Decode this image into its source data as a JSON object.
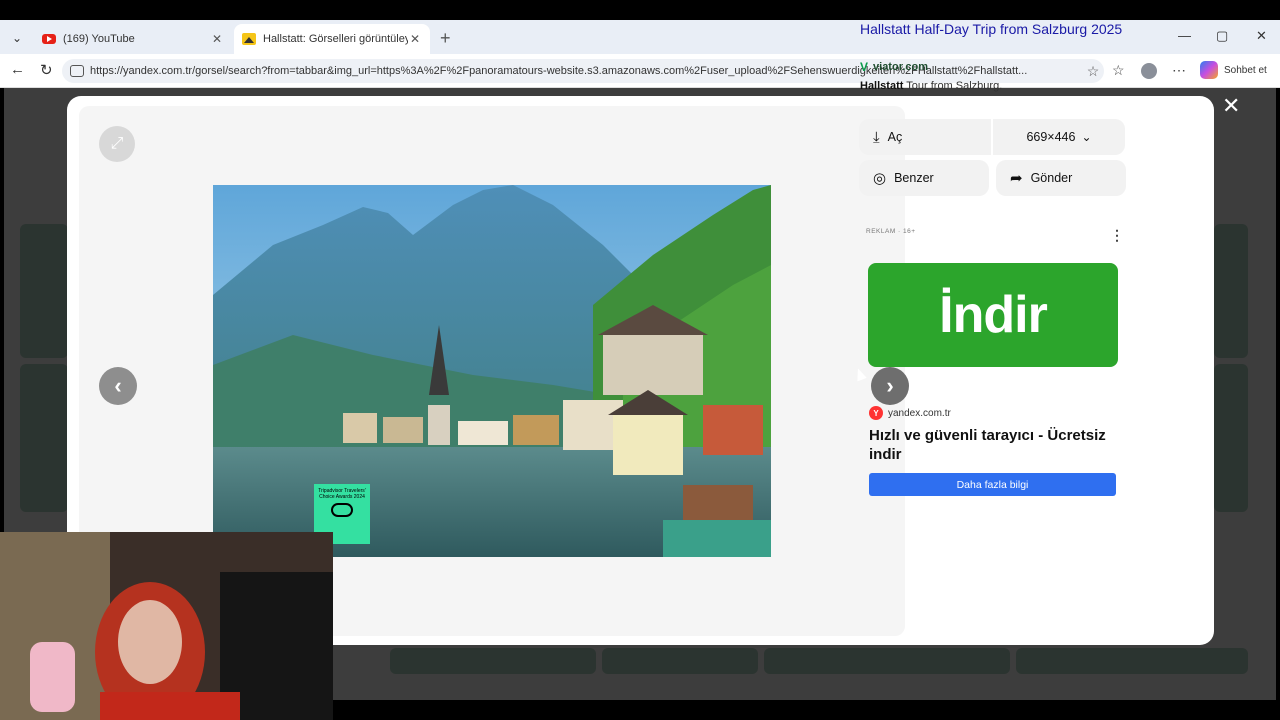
{
  "browser": {
    "tabs": [
      {
        "label": "(169) YouTube",
        "favicon": "youtube-icon"
      },
      {
        "label": "Hallstatt: Görselleri görüntüleyin ve",
        "favicon": "yandex-images-icon",
        "active": true
      }
    ],
    "url": "https://yandex.com.tr/gorsel/search?from=tabbar&img_url=https%3A%2F%2Fpanoramatours-website.s3.amazonaws.com%2Fuser_upload%2FSehenswuerdigkeiten%2FHallstatt%2Fhallstatt...",
    "copilot_label": "Sohbet et"
  },
  "result": {
    "title": "Hallstatt Half-Day Trip from Salzburg 2025",
    "site": "viator.com",
    "desc_bold": "Hallstatt",
    "desc_rest": " Tour from Salzburg.",
    "open_label": "Aç",
    "size_label": "669×446",
    "similar_label": "Benzer",
    "send_label": "Gönder"
  },
  "image": {
    "award_text": "Tripadvisor Travelers' Choice Awards 2024"
  },
  "ad": {
    "label": "REKLAM · 16+",
    "banner_text": "İndir",
    "source": "yandex.com.tr",
    "headline": "Hızlı ve güvenli tarayıcı - Ücretsiz indir",
    "cta": "Daha fazla bilgi"
  },
  "colors": {
    "link": "#1a1aa6",
    "ad_green": "#2ca52c",
    "cta_blue": "#2f6ff0"
  }
}
